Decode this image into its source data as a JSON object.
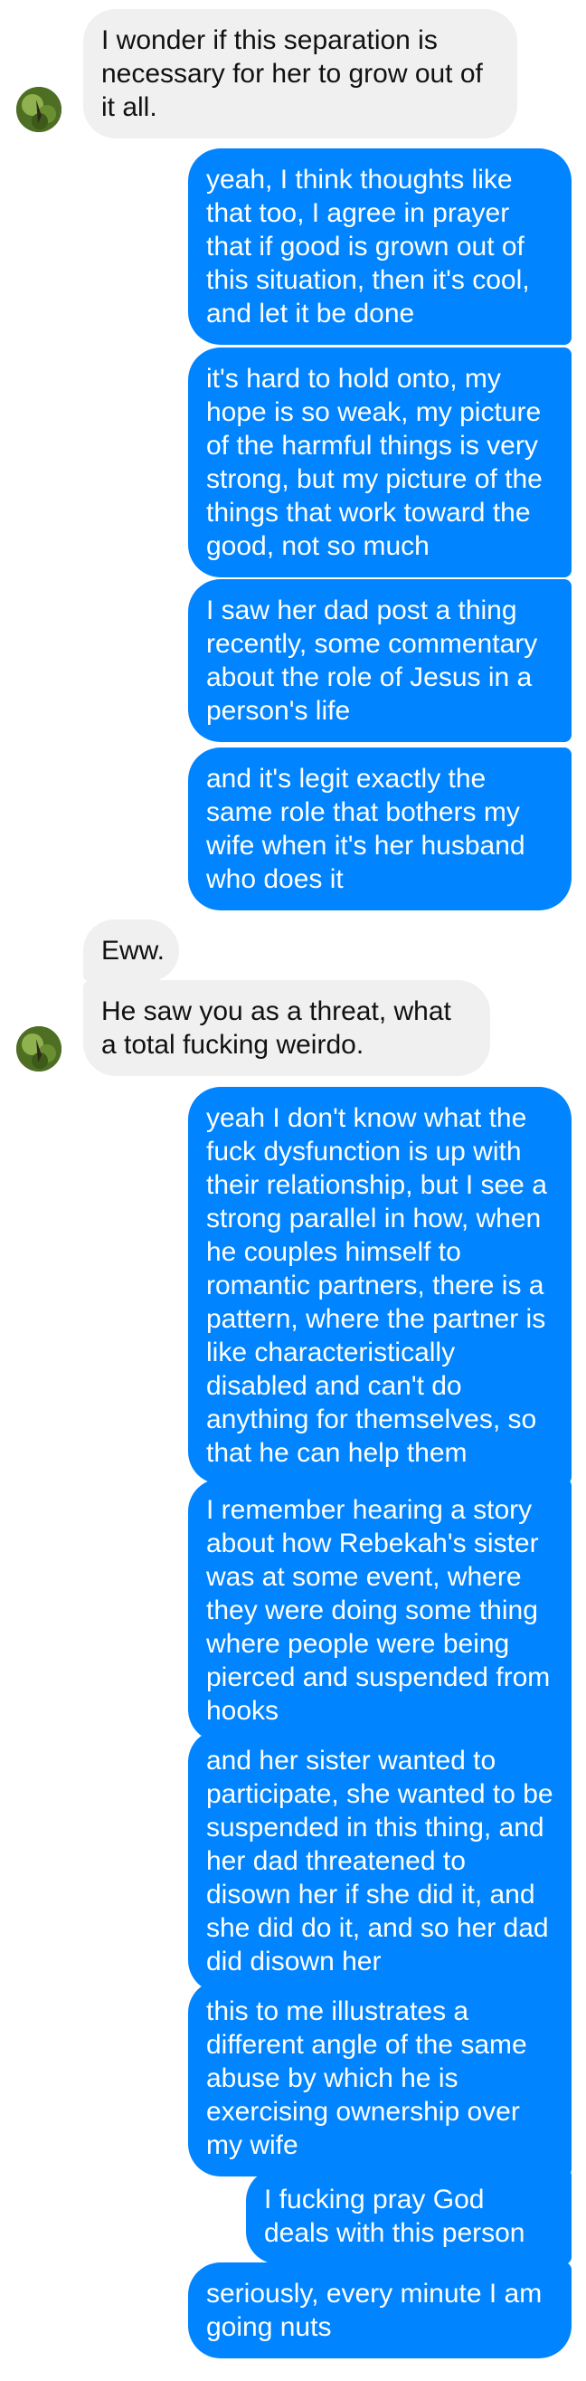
{
  "theme": {
    "incoming_bg": "#f0f0f0",
    "incoming_text": "#111111",
    "outgoing_bg": "#0084ff",
    "outgoing_text": "#ffffff"
  },
  "messages": [
    {
      "sender": "them",
      "text": "I wonder if this separation is necessary for her to grow out of it all."
    },
    {
      "sender": "me",
      "text": "yeah, I think thoughts like that too, I agree in prayer that if good is grown out of this situation, then it's cool, and let it be done"
    },
    {
      "sender": "me",
      "text": "it's hard to hold onto, my hope is so weak, my picture of the harmful things is very strong, but my picture of the things that work toward the good, not so much"
    },
    {
      "sender": "me",
      "text": "I saw her dad post a thing recently, some commentary about the role of Jesus in a person's life"
    },
    {
      "sender": "me",
      "text": "and it's legit exactly the same role that bothers my wife when it's her husband who does it"
    },
    {
      "sender": "them",
      "text": "Eww."
    },
    {
      "sender": "them",
      "text": "He saw you as a threat, what a total fucking weirdo."
    },
    {
      "sender": "me",
      "text": "yeah I don't know what the fuck dysfunction is up with their relationship, but I see a strong parallel in how, when he couples himself to romantic partners, there is a pattern, where the partner is like characteristically disabled and can't do anything for themselves, so that he can help them"
    },
    {
      "sender": "me",
      "text": "I remember hearing a story about how Rebekah's sister was at some event, where they were doing some thing where people were being pierced and suspended from hooks"
    },
    {
      "sender": "me",
      "text": "and her sister wanted to participate, she wanted to be suspended in this thing, and her dad threatened to disown her if she did it, and she did do it, and so her dad did disown her"
    },
    {
      "sender": "me",
      "text": "this to me illustrates a different angle of the same abuse by which he is exercising ownership over my wife"
    },
    {
      "sender": "me",
      "text": "I fucking pray God deals with this person"
    },
    {
      "sender": "me",
      "text": "seriously, every minute I am going nuts"
    }
  ]
}
